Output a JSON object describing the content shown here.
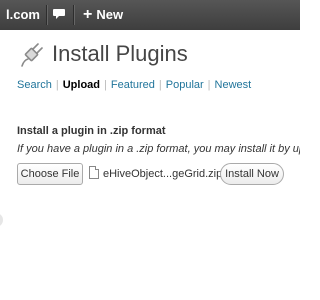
{
  "adminbar": {
    "site_label": "l.com",
    "new_label": "New",
    "icons": [
      "comment-icon",
      "plus-icon"
    ]
  },
  "page": {
    "title": "Install Plugins",
    "icon": "plugin-icon"
  },
  "subnav": {
    "items": [
      {
        "label": "Search",
        "current": false
      },
      {
        "label": "Upload",
        "current": true
      },
      {
        "label": "Featured",
        "current": false
      },
      {
        "label": "Popular",
        "current": false
      },
      {
        "label": "Newest",
        "current": false
      }
    ],
    "separator": "|"
  },
  "upload": {
    "heading": "Install a plugin in .zip format",
    "description": "If you have a plugin in a .zip format, you may install it by uploading it here.",
    "choose_file_label": "Choose File",
    "file_name": "eHiveObject...geGrid.zip",
    "install_label": "Install Now"
  },
  "colors": {
    "adminbar_bg": "#464646",
    "link": "#21759b",
    "title": "#464646"
  }
}
